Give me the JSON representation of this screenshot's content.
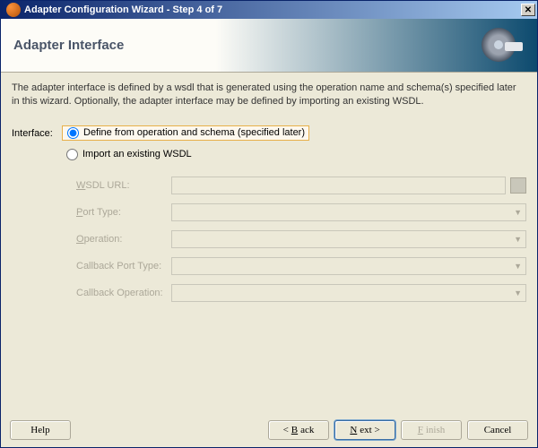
{
  "titlebar": {
    "title": "Adapter Configuration Wizard - Step 4 of 7"
  },
  "header": {
    "title": "Adapter Interface"
  },
  "description": "The adapter interface is defined by a wsdl that is generated using the operation name and schema(s) specified later in this wizard.  Optionally, the adapter interface may be defined by importing an existing WSDL.",
  "form": {
    "interface_label": "Interface:",
    "radio1": "Define from operation and schema (specified later)",
    "radio2": "Import an existing WSDL",
    "fields": {
      "wsdl_url_label": "WSDL URL:",
      "port_type_label": "Port Type:",
      "operation_label": "Operation:",
      "callback_port_label": "Callback Port Type:",
      "callback_op_label": "Callback Operation:",
      "wsdl_url_value": ""
    }
  },
  "buttons": {
    "help": "Help",
    "back": "Back",
    "next": "Next",
    "finish": "Finish",
    "cancel": "Cancel"
  }
}
